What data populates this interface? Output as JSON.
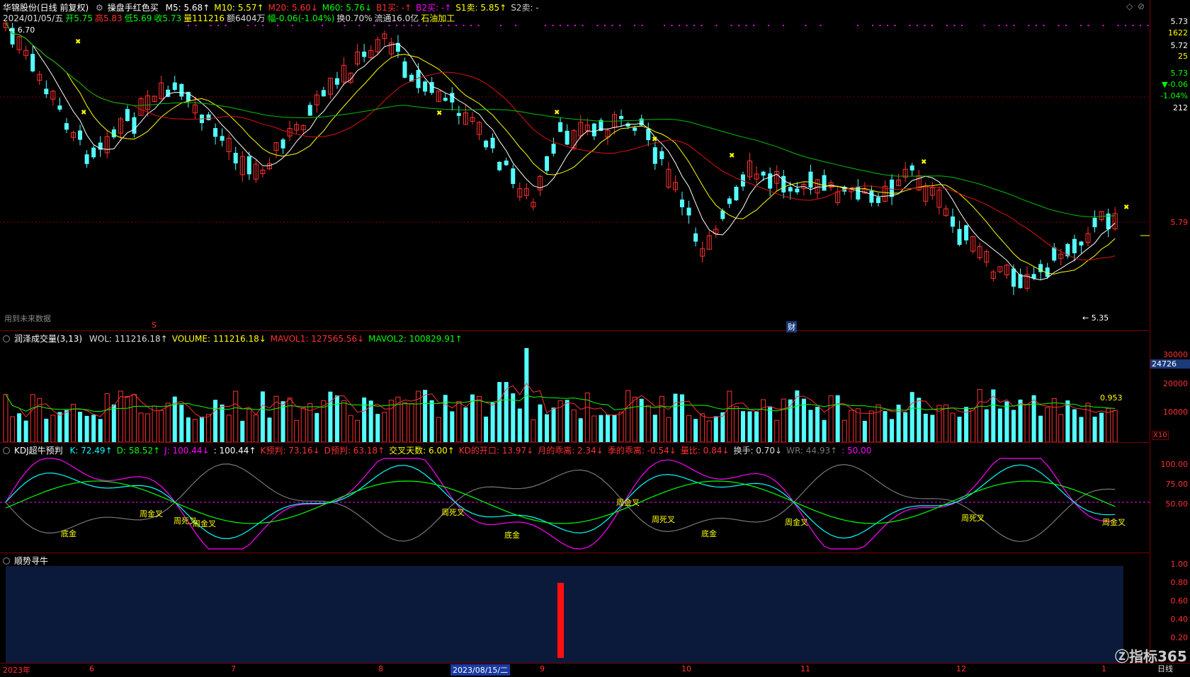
{
  "main": {
    "title": "华锦股份(日线 前复权)",
    "indicator": "操盘手红色买",
    "ma": [
      {
        "label": "M5: 5.68",
        "arrow": "↑",
        "color": "#ffffff"
      },
      {
        "label": "M10: 5.57",
        "arrow": "↑",
        "color": "#ffff00"
      },
      {
        "label": "M20: 5.60",
        "arrow": "↓",
        "color": "#ff3030"
      },
      {
        "label": "M60: 5.76",
        "arrow": "↓",
        "color": "#00ff00"
      },
      {
        "label": "B1买: -",
        "arrow": "↑",
        "color": "#ff3030"
      },
      {
        "label": "B2买: -",
        "arrow": "↑",
        "color": "#ff00ff"
      },
      {
        "label": "S1卖: 5.85",
        "arrow": "↑",
        "color": "#ffff00"
      },
      {
        "label": "S2卖: -",
        "arrow": "",
        "color": "#cccccc"
      }
    ],
    "info": [
      {
        "text": "2024/01/05/五",
        "color": "#dddddd"
      },
      {
        "text": "开5.75",
        "color": "#00ff00"
      },
      {
        "text": "高5.83",
        "color": "#ff3030"
      },
      {
        "text": "低5.69",
        "color": "#00ff00"
      },
      {
        "text": "收5.73",
        "color": "#00ff00"
      },
      {
        "text": "量111216",
        "color": "#ffff00"
      },
      {
        "text": "额6404万",
        "color": "#dddddd"
      },
      {
        "text": "幅-0.06(-1.04%)",
        "color": "#00ff00"
      },
      {
        "text": "换0.70%",
        "color": "#dddddd"
      },
      {
        "text": "流通16.0亿",
        "color": "#dddddd"
      },
      {
        "text": "石油加工",
        "color": "#ffff00"
      }
    ],
    "high_label": "6.70",
    "low_label": "5.35",
    "future_note": "用到未来数据",
    "cai_mark": "财",
    "s_mark": "S"
  },
  "axis_main": [
    {
      "text": "5.73",
      "color": "#ffffff"
    },
    {
      "text": "1622",
      "color": "#ffff00"
    },
    {
      "text": "5.72",
      "color": "#ffffff"
    },
    {
      "text": "25",
      "color": "#ffff00"
    },
    {
      "text": "5.73",
      "color": "#00ff00"
    },
    {
      "text": "▼-0.06",
      "color": "#00ff00"
    },
    {
      "text": "-1.04%",
      "color": "#00ff00"
    },
    {
      "text": "212",
      "color": "#ffffff"
    },
    {
      "text": "5.79",
      "color": "#ff3030"
    }
  ],
  "volume": {
    "name": "润泽成交量(3,13)",
    "items": [
      {
        "label": "WOL: 111216.18",
        "arrow": "↑",
        "color": "#dddddd"
      },
      {
        "label": "VOLUME: 111216.18",
        "arrow": "↓",
        "color": "#ffff00"
      },
      {
        "label": "MAVOL1: 127565.56",
        "arrow": "↓",
        "color": "#ff3030"
      },
      {
        "label": "MAVOL2: 100829.91",
        "arrow": "↑",
        "color": "#00ff00"
      }
    ],
    "ticks": [
      "30000",
      "20000",
      "10000"
    ],
    "badge": "24726",
    "unit": "X10",
    "ratio": "0.953"
  },
  "kdj": {
    "name": "KDJ超牛预判",
    "items": [
      {
        "label": "K: 72.49",
        "arrow": "↑",
        "color": "#00ffff"
      },
      {
        "label": "D: 58.52",
        "arrow": "↑",
        "color": "#00ff00"
      },
      {
        "label": "J: 100.44",
        "arrow": "↓",
        "color": "#ff00ff"
      },
      {
        "label": ": 100.44",
        "arrow": "↑",
        "color": "#ffffff"
      },
      {
        "label": "K预判: 73.16",
        "arrow": "↓",
        "color": "#ff3030"
      },
      {
        "label": "D预判: 63.18",
        "arrow": "↑",
        "color": "#ff3030"
      },
      {
        "label": "交叉天数: 6.00",
        "arrow": "↑",
        "color": "#ffff00"
      },
      {
        "label": "KD的开口: 13.97",
        "arrow": "↓",
        "color": "#ff3030"
      },
      {
        "label": "月的乖离: 2.34",
        "arrow": "↓",
        "color": "#ff3030"
      },
      {
        "label": "季的乖离: -0.54",
        "arrow": "↓",
        "color": "#ff3030"
      },
      {
        "label": "量比: 0.84",
        "arrow": "↓",
        "color": "#ff3030"
      },
      {
        "label": "换手: 0.70",
        "arrow": "↓",
        "color": "#dddddd"
      },
      {
        "label": "WR: 44.93",
        "arrow": "↑",
        "color": "#777777"
      },
      {
        "label": ": 50.00",
        "arrow": "",
        "color": "#ff00ff"
      }
    ],
    "ticks": [
      "100.00",
      "75.00",
      "50.00"
    ],
    "annotations": [
      {
        "text": "底金",
        "color": "#ffff00"
      },
      {
        "text": "周金叉",
        "color": "#ffff00"
      },
      {
        "text": "周死叉",
        "color": "#ffff00"
      },
      {
        "text": "周金叉",
        "color": "#ffff00"
      },
      {
        "text": "周死叉",
        "color": "#ffff00"
      },
      {
        "text": "底金",
        "color": "#ffff00"
      },
      {
        "text": "周金叉",
        "color": "#ffff00"
      },
      {
        "text": "周死叉",
        "color": "#ffff00"
      },
      {
        "text": "底金",
        "color": "#ffff00"
      },
      {
        "text": "周金叉",
        "color": "#ffff00"
      },
      {
        "text": "周死叉",
        "color": "#ffff00"
      },
      {
        "text": "周金叉",
        "color": "#ffff00"
      }
    ]
  },
  "trend": {
    "name": "顺势寻牛",
    "ticks": [
      "1.00",
      "0.80",
      "0.60",
      "0.40",
      "0.20"
    ],
    "bar_value": 0.8
  },
  "time_axis": {
    "labels": [
      "2023年",
      "6",
      "7",
      "8",
      "9",
      "10",
      "11",
      "12",
      "1"
    ],
    "cursor_date": "2023/08/15/二"
  },
  "watermark": {
    "brand": "指标365",
    "period": "日线"
  },
  "colors": {
    "up": "#ff3030",
    "down": "#54ffff",
    "ma5": "#ffffff",
    "ma10": "#ffff00",
    "ma20": "#e01010",
    "ma60": "#00c000",
    "grid": "#7a0000"
  }
}
